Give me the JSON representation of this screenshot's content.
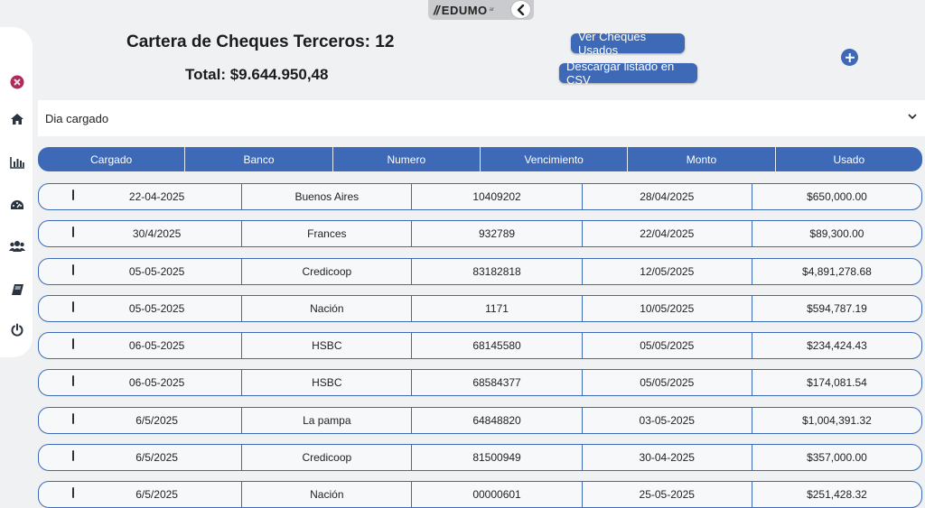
{
  "brand": {
    "logo_text": "EDUMO",
    "logo_sup": "ar"
  },
  "header": {
    "title": "Cartera de Cheques Terceros: 12",
    "total": "Total: $9.644.950,48",
    "btn_used_label": "Ver Cheques Usados",
    "btn_csv_label": "Descargar listado en CSV"
  },
  "filter": {
    "selected": "Dia cargado"
  },
  "table": {
    "columns": [
      "Cargado",
      "Banco",
      "Numero",
      "Vencimiento",
      "Monto",
      "Usado"
    ],
    "rows": [
      [
        "22-04-2025",
        "Buenos Aires",
        "10409202",
        "28/04/2025",
        "$650,000.00"
      ],
      [
        "30/4/2025",
        "Frances",
        "932789",
        "22/04/2025",
        "$89,300.00"
      ],
      [
        "05-05-2025",
        "Credicoop",
        "83182818",
        "12/05/2025",
        "$4,891,278.68"
      ],
      [
        "05-05-2025",
        "Nación",
        "1171",
        "10/05/2025",
        "$594,787.19"
      ],
      [
        "06-05-2025",
        "HSBC",
        "68145580",
        "05/05/2025",
        "$234,424.43"
      ],
      [
        "06-05-2025",
        "HSBC",
        "68584377",
        "05/05/2025",
        "$174,081.54"
      ],
      [
        "6/5/2025",
        "La pampa",
        "64848820",
        "03-05-2025",
        "$1,004,391.32"
      ],
      [
        "6/5/2025",
        "Credicoop",
        "81500949",
        "30-04-2025",
        "$357,000.00"
      ],
      [
        "6/5/2025",
        "Nación",
        "00000601",
        "25-05-2025",
        "$251,428.32"
      ]
    ]
  },
  "sidebar": {
    "items": [
      "close-icon",
      "home-icon",
      "chart-icon",
      "dashboard-icon",
      "users-icon",
      "book-icon",
      "power-icon"
    ]
  },
  "colors": {
    "accent": "#3d69b6",
    "close": "#b02a5b"
  }
}
